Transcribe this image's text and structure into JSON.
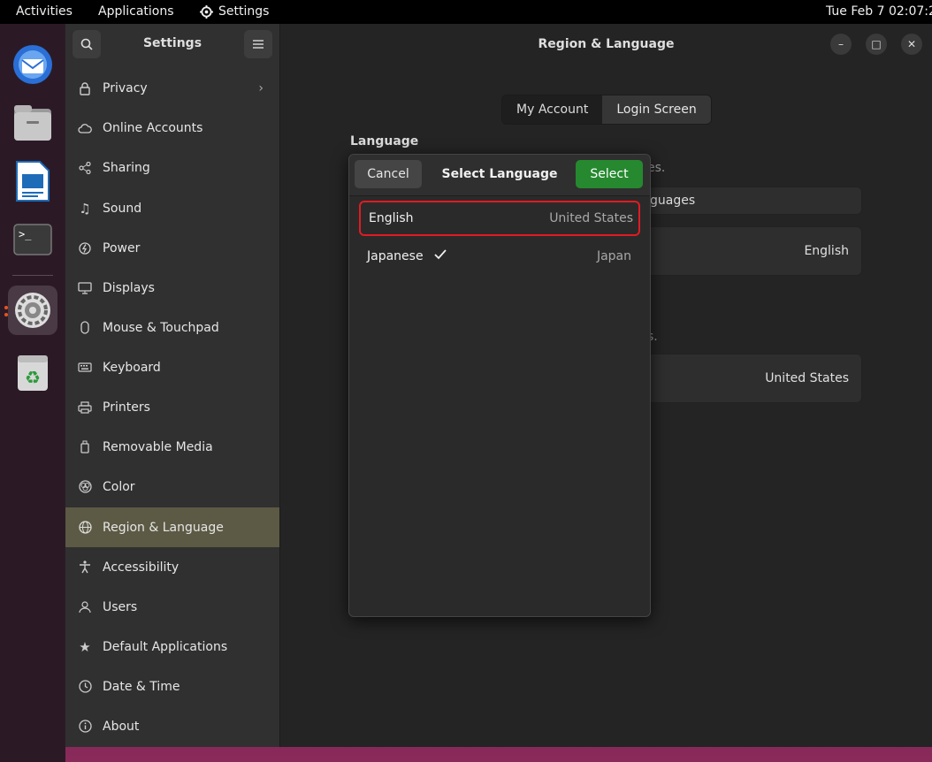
{
  "topbar": {
    "activities": "Activities",
    "applications": "Applications",
    "settings": "Settings",
    "clock": "Tue Feb 7  02:07:2"
  },
  "dock": {
    "items": [
      "thunderbird-icon",
      "files-icon",
      "libreoffice-writer-icon",
      "terminal-icon",
      "settings-icon",
      "trash-icon"
    ],
    "active": "settings-icon"
  },
  "sidebar": {
    "title": "Settings",
    "items": [
      {
        "label": "Privacy",
        "icon": "lock-icon",
        "chevron": true
      },
      {
        "label": "Online Accounts",
        "icon": "cloud-icon"
      },
      {
        "label": "Sharing",
        "icon": "share-icon"
      },
      {
        "label": "Sound",
        "icon": "music-note-icon"
      },
      {
        "label": "Power",
        "icon": "power-icon"
      },
      {
        "label": "Displays",
        "icon": "display-icon"
      },
      {
        "label": "Mouse & Touchpad",
        "icon": "mouse-icon"
      },
      {
        "label": "Keyboard",
        "icon": "keyboard-icon"
      },
      {
        "label": "Printers",
        "icon": "printer-icon"
      },
      {
        "label": "Removable Media",
        "icon": "usb-drive-icon"
      },
      {
        "label": "Color",
        "icon": "color-icon"
      },
      {
        "label": "Region & Language",
        "icon": "globe-icon",
        "selected": true
      },
      {
        "label": "Accessibility",
        "icon": "accessibility-icon"
      },
      {
        "label": "Users",
        "icon": "users-icon"
      },
      {
        "label": "Default Applications",
        "icon": "star-icon"
      },
      {
        "label": "Date & Time",
        "icon": "clock-icon"
      },
      {
        "label": "About",
        "icon": "info-icon"
      }
    ]
  },
  "main": {
    "title": "Region & Language",
    "tabs": [
      "My Account",
      "Login Screen"
    ],
    "active_tab": "Login Screen",
    "language_heading": "Language",
    "bg_language_hint": "es.",
    "bg_languages_link": "guages",
    "bg_language_value": "English",
    "bg_formats_hint": "s.",
    "bg_formats_value": "United States"
  },
  "dialog": {
    "title": "Select Language",
    "cancel": "Cancel",
    "select": "Select",
    "rows": [
      {
        "name": "English",
        "region": "United States",
        "highlighted": true,
        "checked": false
      },
      {
        "name": "Japanese",
        "region": "Japan",
        "highlighted": false,
        "checked": true
      }
    ]
  },
  "colors": {
    "accent_green": "#26892f",
    "selection": "#5c5a44",
    "highlight_border": "#e01b24"
  }
}
